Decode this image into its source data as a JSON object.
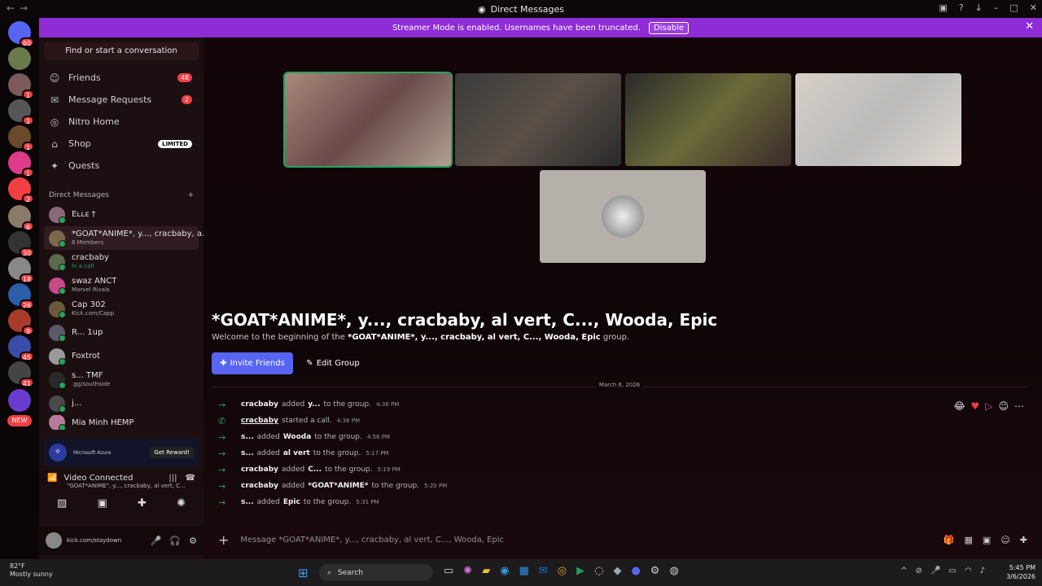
{
  "titlebar": {
    "title": "Direct Messages"
  },
  "banner": {
    "text": "Streamer Mode is enabled. Usernames have been truncated.",
    "disable": "Disable"
  },
  "guild_badges": [
    "60",
    "",
    "1",
    "1",
    "1",
    "1",
    "2",
    "6",
    "30",
    "18",
    "26",
    "9",
    "45",
    "41",
    "",
    ""
  ],
  "sidebar": {
    "find": "Find or start a conversation",
    "nav": [
      {
        "label": "Friends",
        "count": "48"
      },
      {
        "label": "Message Requests",
        "count": "2"
      },
      {
        "label": "Nitro Home",
        "count": ""
      },
      {
        "label": "Shop",
        "tag": "LIMITED"
      },
      {
        "label": "Quests",
        "count": ""
      }
    ],
    "dm_header": "Direct Messages",
    "dms": [
      {
        "name": "Eʟʟᴇ †",
        "sub": ""
      },
      {
        "name": "*GOAT*ANIME*, y..., cracbaby, a...",
        "sub": "8 Members"
      },
      {
        "name": "cracbaby",
        "sub": "In a call"
      },
      {
        "name": "swaz  ANCT",
        "sub": "Marvel Rivals"
      },
      {
        "name": "Cap  302",
        "sub": "Kick.com/Capp"
      },
      {
        "name": "R...  1up",
        "sub": ""
      },
      {
        "name": "Foxtrot",
        "sub": ""
      },
      {
        "name": "s...  TMF",
        "sub": ".gg/southside"
      },
      {
        "name": "j...",
        "sub": ""
      },
      {
        "name": "Mia Minh  HEMP",
        "sub": ""
      }
    ],
    "reward": {
      "brand": "Microsoft Azure",
      "button": "Get Reward!"
    },
    "voice": {
      "status": "Video Connected",
      "channel": "\"GOAT*ANIME\", y..., cracbaby, al vert, C..."
    },
    "user": {
      "status": "kick.com/staydown"
    }
  },
  "main": {
    "title": "*GOAT*ANIME*, y..., cracbaby, al vert, C..., Wooda, Epic",
    "welcome_pre": "Welcome to the beginning of the ",
    "welcome_bold": "*GOAT*ANIME*, y..., cracbaby, al vert, C..., Wooda, Epic",
    "welcome_post": " group.",
    "invite": "Invite Friends",
    "edit": "Edit Group",
    "date": "March 6, 2026",
    "messages": [
      {
        "actor": "cracbaby",
        "mid": " added ",
        "target": "y...",
        "tail": " to the group.",
        "time": "4:36 PM",
        "type": "add"
      },
      {
        "actor": "cracbaby",
        "mid": " started a call.",
        "target": "",
        "tail": "",
        "time": "4:36 PM",
        "type": "call"
      },
      {
        "actor": "s...",
        "mid": " added ",
        "target": "Wooda",
        "tail": " to the group.",
        "time": "4:56 PM",
        "type": "add"
      },
      {
        "actor": "s...",
        "mid": " added ",
        "target": "al vert",
        "tail": " to the group.",
        "time": "5:17 PM",
        "type": "add"
      },
      {
        "actor": "cracbaby",
        "mid": " added ",
        "target": "C...",
        "tail": " to the group.",
        "time": "5:19 PM",
        "type": "add"
      },
      {
        "actor": "cracbaby",
        "mid": " added ",
        "target": "*GOAT*ANIME*",
        "tail": " to the group.",
        "time": "5:20 PM",
        "type": "add"
      },
      {
        "actor": "s...",
        "mid": " added ",
        "target": "Epic",
        "tail": " to the group.",
        "time": "5:31 PM",
        "type": "add"
      }
    ],
    "placeholder": "Message *GOAT*ANIME*, y..., cracbaby, al vert, C..., Wooda, Epic"
  },
  "taskbar": {
    "temp": "82°F",
    "weather": "Mostly sunny",
    "search": "Search",
    "time": "5:45 PM",
    "date": "3/6/2026"
  },
  "colors": {
    "accent": "#5865f2",
    "banner": "#8e2cd6",
    "online": "#23a55a",
    "badge": "#f23f43"
  }
}
